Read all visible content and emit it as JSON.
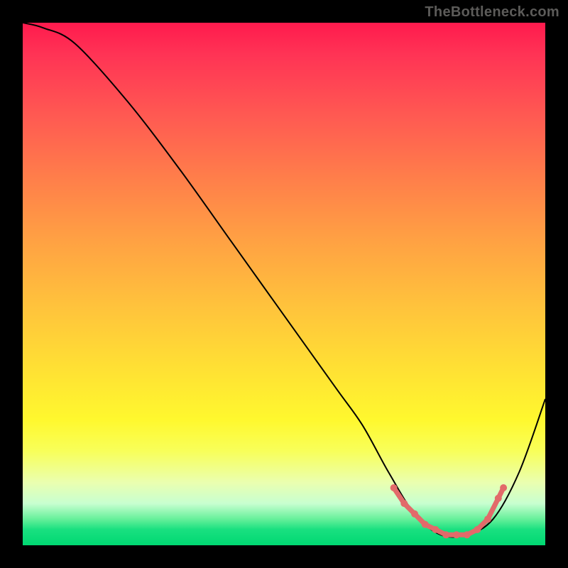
{
  "watermark": "TheBottleneck.com",
  "chart_data": {
    "type": "line",
    "title": "",
    "xlabel": "",
    "ylabel": "",
    "xlim": [
      0,
      100
    ],
    "ylim": [
      0,
      100
    ],
    "grid": false,
    "series": [
      {
        "name": "bottleneck-curve",
        "x": [
          0,
          4,
          10,
          20,
          30,
          40,
          50,
          60,
          65,
          70,
          75,
          80,
          85,
          90,
          95,
          100
        ],
        "y": [
          100,
          99,
          96,
          85,
          72,
          58,
          44,
          30,
          23,
          14,
          6,
          2,
          2,
          5,
          14,
          28
        ]
      }
    ],
    "highlight_range": {
      "description": "optimal-region",
      "x_start": 71,
      "x_end": 92,
      "markers_x": [
        71,
        73,
        75,
        77,
        79,
        81,
        83,
        85,
        87,
        89,
        91,
        92
      ],
      "markers_y": [
        11,
        8,
        6,
        4,
        3,
        2,
        2,
        2,
        3,
        5,
        9,
        11
      ]
    }
  }
}
